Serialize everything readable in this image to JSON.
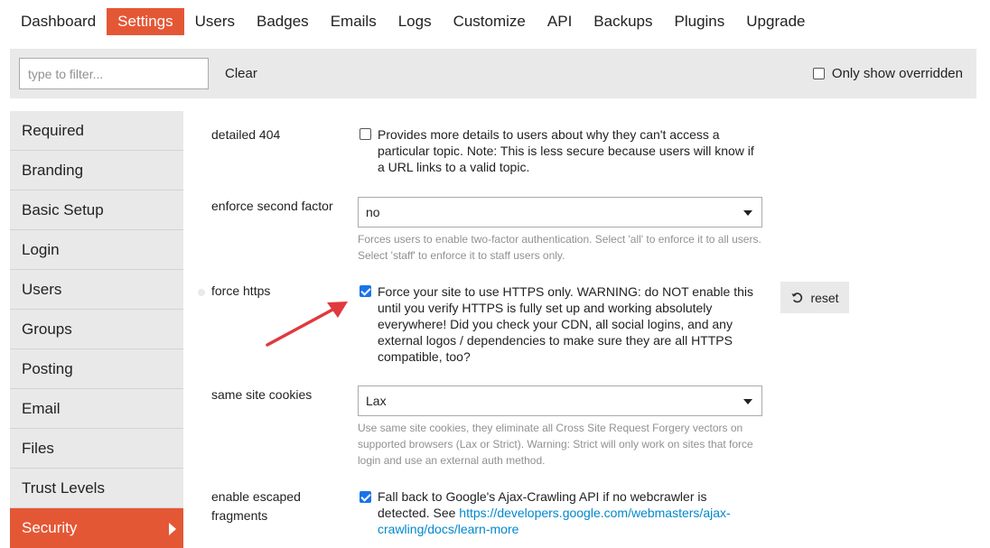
{
  "nav": {
    "items": [
      {
        "label": "Dashboard"
      },
      {
        "label": "Settings"
      },
      {
        "label": "Users"
      },
      {
        "label": "Badges"
      },
      {
        "label": "Emails"
      },
      {
        "label": "Logs"
      },
      {
        "label": "Customize"
      },
      {
        "label": "API"
      },
      {
        "label": "Backups"
      },
      {
        "label": "Plugins"
      },
      {
        "label": "Upgrade"
      }
    ],
    "active": "Settings"
  },
  "filter": {
    "placeholder": "type to filter...",
    "value": "",
    "clear_label": "Clear",
    "only_overridden_label": "Only show overridden",
    "only_overridden_checked": false
  },
  "sidebar": {
    "items": [
      {
        "label": "Required"
      },
      {
        "label": "Branding"
      },
      {
        "label": "Basic Setup"
      },
      {
        "label": "Login"
      },
      {
        "label": "Users"
      },
      {
        "label": "Groups"
      },
      {
        "label": "Posting"
      },
      {
        "label": "Email"
      },
      {
        "label": "Files"
      },
      {
        "label": "Trust Levels"
      },
      {
        "label": "Security"
      }
    ],
    "active": "Security"
  },
  "settings": {
    "detailed_404": {
      "label": "detailed 404",
      "checked": false,
      "description": "Provides more details to users about why they can't access a particular topic. Note: This is less secure because users will know if a URL links to a valid topic."
    },
    "enforce_second_factor": {
      "label": "enforce second factor",
      "value": "no",
      "help": "Forces users to enable two-factor authentication. Select 'all' to enforce it to all users. Select 'staff' to enforce it to staff users only."
    },
    "force_https": {
      "label": "force https",
      "checked": true,
      "description": "Force your site to use HTTPS only. WARNING: do NOT enable this until you verify HTTPS is fully set up and working absolutely everywhere! Did you check your CDN, all social logins, and any external logos / dependencies to make sure they are all HTTPS compatible, too?",
      "reset_label": "reset"
    },
    "same_site_cookies": {
      "label": "same site cookies",
      "value": "Lax",
      "help": "Use same site cookies, they eliminate all Cross Site Request Forgery vectors on supported browsers (Lax or Strict). Warning: Strict will only work on sites that force login and use an external auth method."
    },
    "enable_escaped_fragments": {
      "label": "enable escaped fragments",
      "checked": true,
      "description_prefix": "Fall back to Google's Ajax-Crawling API if no webcrawler is detected. See",
      "link_text": "https://developers.google.com/webmasters/ajax-crawling/docs/learn-more"
    }
  },
  "colors": {
    "accent": "#e45735",
    "annotation_arrow": "#e0393e",
    "checkbox": "#1a73e8",
    "link": "#0088cc"
  }
}
